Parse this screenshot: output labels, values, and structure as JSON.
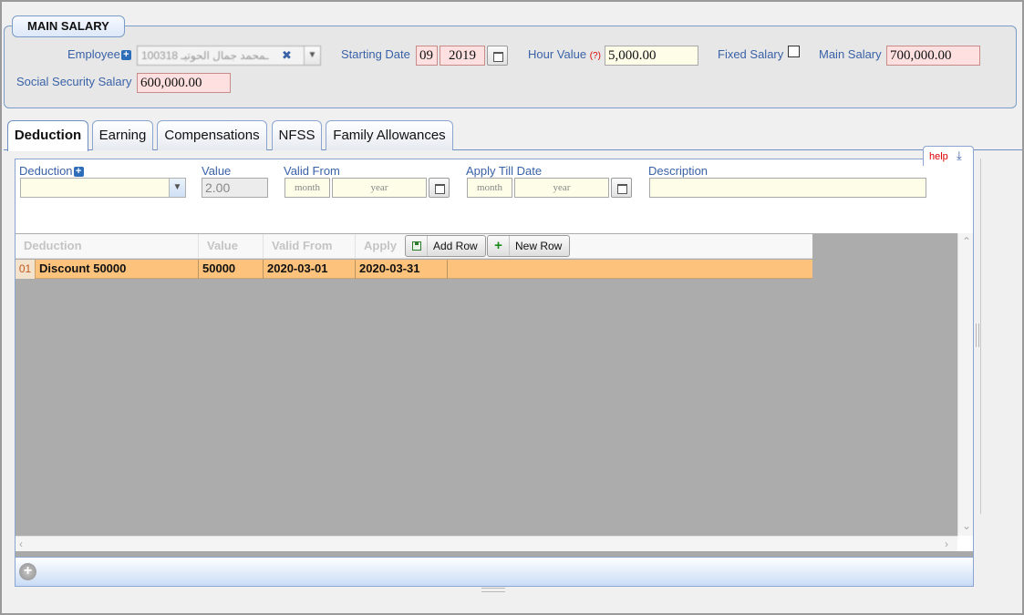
{
  "main_salary": {
    "legend": "MAIN SALARY",
    "employee_label": "Employee",
    "employee_value": "100318 ـمحمد جمال الحوتيـ",
    "starting_date_label": "Starting Date",
    "starting_month": "09",
    "starting_year": "2019",
    "hour_value_label": "Hour Value",
    "hour_value_hint": "(?)",
    "hour_value": "5,000.00",
    "fixed_salary_label": "Fixed Salary",
    "main_salary_label": "Main Salary",
    "main_salary_value": "700,000.00",
    "ss_salary_label": "Social Security Salary",
    "ss_salary_value": "600,000.00"
  },
  "tabs": [
    {
      "label": "Deduction",
      "active": true
    },
    {
      "label": "Earning"
    },
    {
      "label": "Compensations"
    },
    {
      "label": "NFSS"
    },
    {
      "label": "Family Allowances"
    }
  ],
  "help": {
    "label": "help",
    "icon": "download-icon"
  },
  "form": {
    "deduction_label": "Deduction",
    "deduction_value": "",
    "value_label": "Value",
    "value": "2.00",
    "valid_from_label": "Valid From",
    "valid_from_month_ph": "month",
    "valid_from_year_ph": "year",
    "apply_till_label": "Apply Till Date",
    "apply_till_month_ph": "month",
    "apply_till_year_ph": "year",
    "description_label": "Description",
    "description_value": ""
  },
  "grid": {
    "columns": [
      "Deduction",
      "Value",
      "Valid From",
      "Apply T"
    ],
    "add_row_label": "Add Row",
    "new_row_label": "New Row",
    "rows": [
      {
        "num": "01",
        "deduction": "Discount 50000",
        "value": "50000",
        "valid_from": "2020-03-01",
        "apply_till": "2020-03-31"
      }
    ]
  },
  "colors": {
    "accent": "#3a62a7",
    "selected_row": "#fdc37c",
    "required_field": "#ffe0e0"
  }
}
